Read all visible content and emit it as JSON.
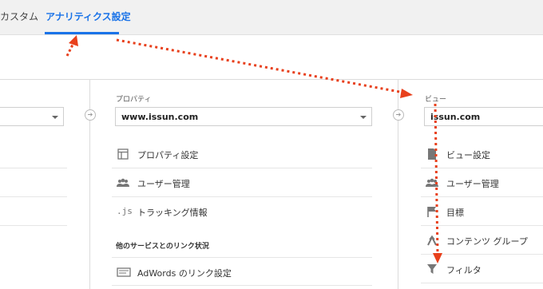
{
  "tabs": [
    {
      "label": "カスタム",
      "active": false
    },
    {
      "label": "アナリティクス設定",
      "active": true
    }
  ],
  "property": {
    "column_label": "プロパティ",
    "selected": "www.issun.com",
    "items": [
      {
        "label": "プロパティ設定",
        "icon": "property-settings-icon"
      },
      {
        "label": "ユーザー管理",
        "icon": "users-icon"
      },
      {
        "label": "トラッキング情報",
        "icon": "js-icon"
      }
    ],
    "section_title": "他のサービスとのリンク状況",
    "links": [
      {
        "label": "AdWords のリンク設定",
        "icon": "adwords-icon"
      }
    ]
  },
  "view": {
    "column_label": "ビュー",
    "selected": "issun.com",
    "items": [
      {
        "label": "ビュー設定",
        "icon": "document-icon"
      },
      {
        "label": "ユーザー管理",
        "icon": "users-icon"
      },
      {
        "label": "目標",
        "icon": "flag-icon"
      },
      {
        "label": "コンテンツ グループ",
        "icon": "content-group-icon"
      },
      {
        "label": "フィルタ",
        "icon": "filter-icon"
      }
    ]
  },
  "colors": {
    "accent": "#1a73e8",
    "annotation": "#e8401c"
  }
}
